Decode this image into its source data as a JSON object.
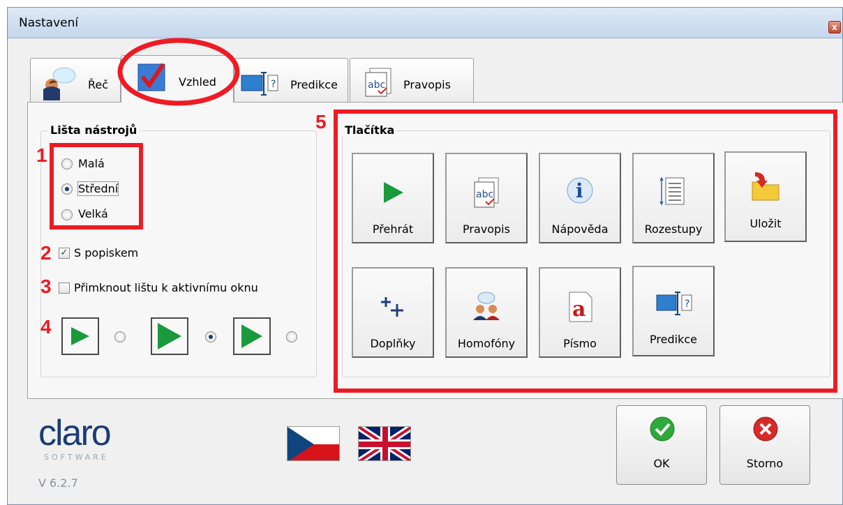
{
  "window": {
    "title": "Nastavení",
    "close": "x"
  },
  "tabs": [
    {
      "label": "Řeč",
      "icon": "speech-person-icon"
    },
    {
      "label": "Vzhled",
      "icon": "checkmark-icon",
      "active": true
    },
    {
      "label": "Predikce",
      "icon": "prediction-icon"
    },
    {
      "label": "Pravopis",
      "icon": "spelling-icon"
    }
  ],
  "toolbar_group": {
    "title": "Lišta nástrojů",
    "size_options": [
      {
        "label": "Malá",
        "checked": false
      },
      {
        "label": "Střední",
        "checked": true
      },
      {
        "label": "Velká",
        "checked": false
      }
    ],
    "with_label": {
      "label": "S popiskem",
      "checked": true
    },
    "dock": {
      "label": "Přimknout lištu k aktivnímu oknu",
      "checked": false
    },
    "icon_sizes": [
      {
        "checked": false
      },
      {
        "checked": true
      },
      {
        "checked": false
      }
    ]
  },
  "buttons_group": {
    "title": "Tlačítka",
    "buttons": [
      {
        "label": "Přehrát",
        "icon": "play-icon"
      },
      {
        "label": "Pravopis",
        "icon": "spelling-icon"
      },
      {
        "label": "Nápověda",
        "icon": "info-icon"
      },
      {
        "label": "Rozestupy",
        "icon": "spacing-icon"
      },
      {
        "label": "Uložit",
        "icon": "save-folder-icon"
      },
      {
        "label": "Doplňky",
        "icon": "addons-icon"
      },
      {
        "label": "Homofóny",
        "icon": "homophones-icon"
      },
      {
        "label": "Písmo",
        "icon": "font-icon"
      },
      {
        "label": "Predikce",
        "icon": "prediction-icon"
      }
    ]
  },
  "annotations": [
    "1",
    "2",
    "3",
    "4",
    "5"
  ],
  "footer": {
    "logo_text": "claro",
    "logo_sub": "SOFTWARE",
    "version": "V 6.2.7",
    "ok_label": "OK",
    "cancel_label": "Storno"
  },
  "colors": {
    "accent_red": "#ee1b24",
    "play_green": "#1a9a3c",
    "ok_green": "#2fa83c",
    "cancel_red": "#d62a2a"
  }
}
